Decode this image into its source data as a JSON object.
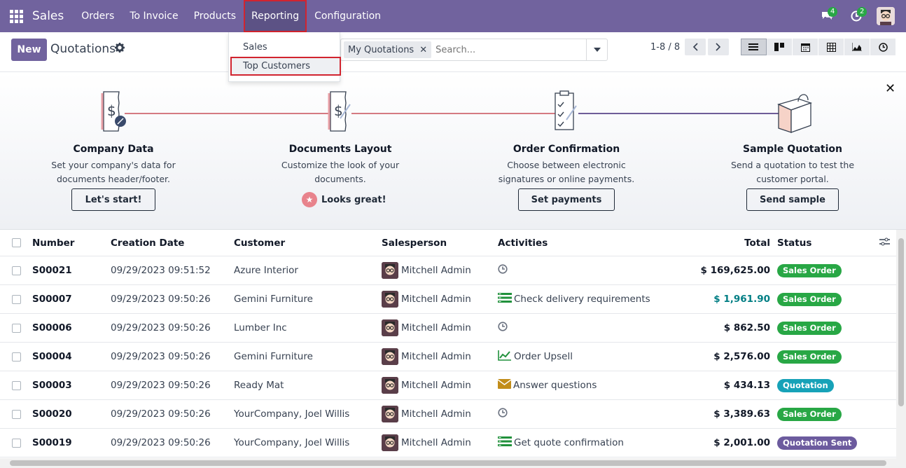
{
  "navbar": {
    "brand": "Sales",
    "menu": [
      "Orders",
      "To Invoice",
      "Products",
      "Reporting",
      "Configuration"
    ],
    "messages_count": "4",
    "activities_count": "2"
  },
  "reporting_menu": {
    "items": [
      "Sales",
      "Top Customers"
    ]
  },
  "control_panel": {
    "new_label": "New",
    "title": "Quotations",
    "facet": "My Quotations",
    "search_placeholder": "Search...",
    "pager": "1-8 / 8"
  },
  "onboarding": {
    "steps": [
      {
        "title": "Company Data",
        "desc": "Set your company's data for documents header/footer.",
        "action": "Let's start!"
      },
      {
        "title": "Documents Layout",
        "desc": "Customize the look of your documents.",
        "done": "Looks great!"
      },
      {
        "title": "Order Confirmation",
        "desc": "Choose between electronic signatures or online payments.",
        "action": "Set payments"
      },
      {
        "title": "Sample Quotation",
        "desc": "Send a quotation to test the customer portal.",
        "action": "Send sample"
      }
    ]
  },
  "table": {
    "headers": [
      "Number",
      "Creation Date",
      "Customer",
      "Salesperson",
      "Activities",
      "Total",
      "Status"
    ],
    "rows": [
      {
        "number": "S00021",
        "date": "09/29/2023 09:51:52",
        "customer": "Azure Interior",
        "salesperson": "Mitchell Admin",
        "activity_icon": "clock-icon",
        "activity": "",
        "total": "$ 169,625.00",
        "status": "Sales Order"
      },
      {
        "number": "S00007",
        "date": "09/29/2023 09:50:26",
        "customer": "Gemini Furniture",
        "salesperson": "Mitchell Admin",
        "activity_icon": "todo-icon",
        "activity": "Check delivery requirements",
        "total": "$ 1,961.90",
        "status": "Sales Order"
      },
      {
        "number": "S00006",
        "date": "09/29/2023 09:50:26",
        "customer": "Lumber Inc",
        "salesperson": "Mitchell Admin",
        "activity_icon": "clock-icon",
        "activity": "",
        "total": "$ 862.50",
        "status": "Sales Order"
      },
      {
        "number": "S00004",
        "date": "09/29/2023 09:50:26",
        "customer": "Gemini Furniture",
        "salesperson": "Mitchell Admin",
        "activity_icon": "chart-line-icon",
        "activity": "Order Upsell",
        "total": "$ 2,576.00",
        "status": "Sales Order"
      },
      {
        "number": "S00003",
        "date": "09/29/2023 09:50:26",
        "customer": "Ready Mat",
        "salesperson": "Mitchell Admin",
        "activity_icon": "envelope-icon",
        "activity": "Answer questions",
        "total": "$ 434.13",
        "status": "Quotation"
      },
      {
        "number": "S00020",
        "date": "09/29/2023 09:50:26",
        "customer": "YourCompany, Joel Willis",
        "salesperson": "Mitchell Admin",
        "activity_icon": "clock-icon",
        "activity": "",
        "total": "$ 3,389.63",
        "status": "Sales Order"
      },
      {
        "number": "S00019",
        "date": "09/29/2023 09:50:26",
        "customer": "YourCompany, Joel Willis",
        "salesperson": "Mitchell Admin",
        "activity_icon": "todo-icon",
        "activity": "Get quote confirmation",
        "total": "$ 2,001.00",
        "status": "Quotation Sent"
      }
    ]
  },
  "colors": {
    "brand": "#71639e",
    "sales_order": "#28a745",
    "quotation": "#17a2b8",
    "quotation_sent": "#6c5b9e",
    "highlight_border": "#d1242f",
    "link_total": "#017e84"
  }
}
